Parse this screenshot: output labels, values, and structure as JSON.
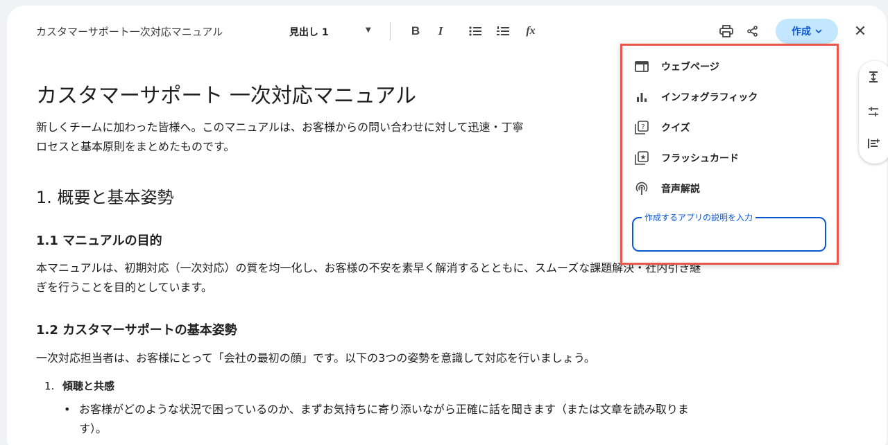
{
  "toolbar": {
    "doc_name": "カスタマーサポート一次対応マニュアル",
    "heading_style": "見出し 1",
    "create_label": "作成"
  },
  "document": {
    "title": "カスタマーサポート 一次対応マニュアル",
    "intro_line1": "新しくチームに加わった皆様へ。このマニュアルは、お客様からの問い合わせに対して迅速・丁寧",
    "intro_line2": "ロセスと基本原則をまとめたものです。",
    "section1": "1. 概要と基本姿勢",
    "section1_1": "1.1 マニュアルの目的",
    "s11_line1": "本マニュアルは、初期対応（一次対応）の質を均一化し、お客様の不安を素早く解消するとともに、スムーズな課題解決・社内引き継",
    "s11_line2": "ぎを行うことを目的としています。",
    "section1_2": "1.2 カスタマーサポートの基本姿勢",
    "s12_line": "一次対応担当者は、お客様にとって「会社の最初の顔」です。以下の3つの姿勢を意識して対応を行いましょう。",
    "list1_num": "1.",
    "list1_label": "傾聴と共感",
    "bullet1_line1": "お客様がどのような状況で困っているのか、まずお気持ちに寄り添いながら正確に話を聞きます（または文章を読み取りま",
    "bullet1_line2": "す）。"
  },
  "menu": {
    "items": [
      {
        "label": "ウェブページ",
        "icon": "webpage-icon"
      },
      {
        "label": "インフォグラフィック",
        "icon": "bar-chart-icon"
      },
      {
        "label": "クイズ",
        "icon": "quiz-icon"
      },
      {
        "label": "フラッシュカード",
        "icon": "flashcard-icon"
      },
      {
        "label": "音声解説",
        "icon": "podcast-icon"
      }
    ],
    "prompt_label": "作成するアプリの説明を入力"
  },
  "colors": {
    "accent": "#0b57d0",
    "create_bg": "#c2e7ff",
    "highlight_border": "#e8574a"
  }
}
